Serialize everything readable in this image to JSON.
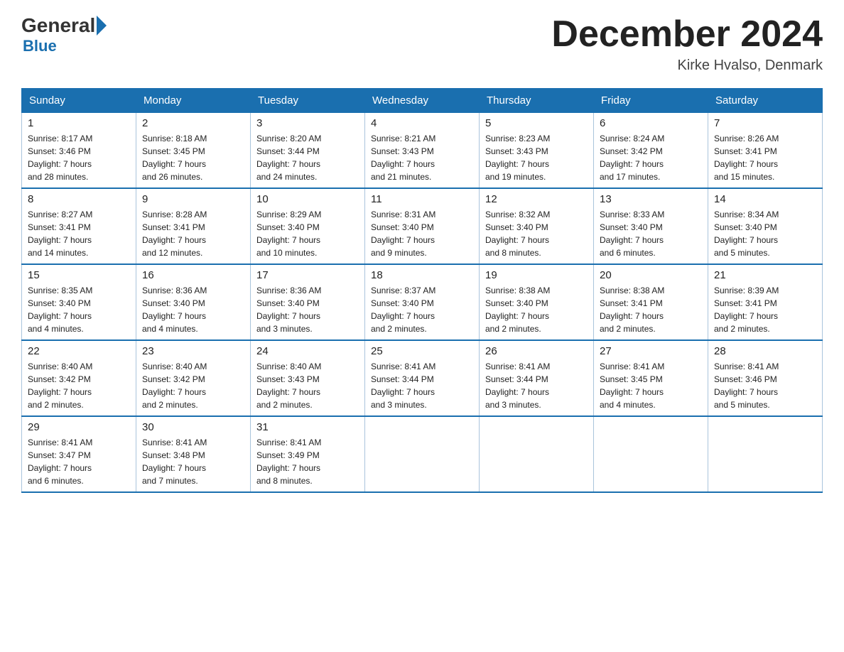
{
  "header": {
    "logo_general": "General",
    "logo_blue": "Blue",
    "month_title": "December 2024",
    "location": "Kirke Hvalso, Denmark"
  },
  "days_of_week": [
    "Sunday",
    "Monday",
    "Tuesday",
    "Wednesday",
    "Thursday",
    "Friday",
    "Saturday"
  ],
  "weeks": [
    [
      {
        "day": "1",
        "sunrise": "8:17 AM",
        "sunset": "3:46 PM",
        "daylight": "7 hours and 28 minutes."
      },
      {
        "day": "2",
        "sunrise": "8:18 AM",
        "sunset": "3:45 PM",
        "daylight": "7 hours and 26 minutes."
      },
      {
        "day": "3",
        "sunrise": "8:20 AM",
        "sunset": "3:44 PM",
        "daylight": "7 hours and 24 minutes."
      },
      {
        "day": "4",
        "sunrise": "8:21 AM",
        "sunset": "3:43 PM",
        "daylight": "7 hours and 21 minutes."
      },
      {
        "day": "5",
        "sunrise": "8:23 AM",
        "sunset": "3:43 PM",
        "daylight": "7 hours and 19 minutes."
      },
      {
        "day": "6",
        "sunrise": "8:24 AM",
        "sunset": "3:42 PM",
        "daylight": "7 hours and 17 minutes."
      },
      {
        "day": "7",
        "sunrise": "8:26 AM",
        "sunset": "3:41 PM",
        "daylight": "7 hours and 15 minutes."
      }
    ],
    [
      {
        "day": "8",
        "sunrise": "8:27 AM",
        "sunset": "3:41 PM",
        "daylight": "7 hours and 14 minutes."
      },
      {
        "day": "9",
        "sunrise": "8:28 AM",
        "sunset": "3:41 PM",
        "daylight": "7 hours and 12 minutes."
      },
      {
        "day": "10",
        "sunrise": "8:29 AM",
        "sunset": "3:40 PM",
        "daylight": "7 hours and 10 minutes."
      },
      {
        "day": "11",
        "sunrise": "8:31 AM",
        "sunset": "3:40 PM",
        "daylight": "7 hours and 9 minutes."
      },
      {
        "day": "12",
        "sunrise": "8:32 AM",
        "sunset": "3:40 PM",
        "daylight": "7 hours and 8 minutes."
      },
      {
        "day": "13",
        "sunrise": "8:33 AM",
        "sunset": "3:40 PM",
        "daylight": "7 hours and 6 minutes."
      },
      {
        "day": "14",
        "sunrise": "8:34 AM",
        "sunset": "3:40 PM",
        "daylight": "7 hours and 5 minutes."
      }
    ],
    [
      {
        "day": "15",
        "sunrise": "8:35 AM",
        "sunset": "3:40 PM",
        "daylight": "7 hours and 4 minutes."
      },
      {
        "day": "16",
        "sunrise": "8:36 AM",
        "sunset": "3:40 PM",
        "daylight": "7 hours and 4 minutes."
      },
      {
        "day": "17",
        "sunrise": "8:36 AM",
        "sunset": "3:40 PM",
        "daylight": "7 hours and 3 minutes."
      },
      {
        "day": "18",
        "sunrise": "8:37 AM",
        "sunset": "3:40 PM",
        "daylight": "7 hours and 2 minutes."
      },
      {
        "day": "19",
        "sunrise": "8:38 AM",
        "sunset": "3:40 PM",
        "daylight": "7 hours and 2 minutes."
      },
      {
        "day": "20",
        "sunrise": "8:38 AM",
        "sunset": "3:41 PM",
        "daylight": "7 hours and 2 minutes."
      },
      {
        "day": "21",
        "sunrise": "8:39 AM",
        "sunset": "3:41 PM",
        "daylight": "7 hours and 2 minutes."
      }
    ],
    [
      {
        "day": "22",
        "sunrise": "8:40 AM",
        "sunset": "3:42 PM",
        "daylight": "7 hours and 2 minutes."
      },
      {
        "day": "23",
        "sunrise": "8:40 AM",
        "sunset": "3:42 PM",
        "daylight": "7 hours and 2 minutes."
      },
      {
        "day": "24",
        "sunrise": "8:40 AM",
        "sunset": "3:43 PM",
        "daylight": "7 hours and 2 minutes."
      },
      {
        "day": "25",
        "sunrise": "8:41 AM",
        "sunset": "3:44 PM",
        "daylight": "7 hours and 3 minutes."
      },
      {
        "day": "26",
        "sunrise": "8:41 AM",
        "sunset": "3:44 PM",
        "daylight": "7 hours and 3 minutes."
      },
      {
        "day": "27",
        "sunrise": "8:41 AM",
        "sunset": "3:45 PM",
        "daylight": "7 hours and 4 minutes."
      },
      {
        "day": "28",
        "sunrise": "8:41 AM",
        "sunset": "3:46 PM",
        "daylight": "7 hours and 5 minutes."
      }
    ],
    [
      {
        "day": "29",
        "sunrise": "8:41 AM",
        "sunset": "3:47 PM",
        "daylight": "7 hours and 6 minutes."
      },
      {
        "day": "30",
        "sunrise": "8:41 AM",
        "sunset": "3:48 PM",
        "daylight": "7 hours and 7 minutes."
      },
      {
        "day": "31",
        "sunrise": "8:41 AM",
        "sunset": "3:49 PM",
        "daylight": "7 hours and 8 minutes."
      },
      null,
      null,
      null,
      null
    ]
  ],
  "labels": {
    "sunrise_prefix": "Sunrise: ",
    "sunset_prefix": "Sunset: ",
    "daylight_prefix": "Daylight: "
  }
}
